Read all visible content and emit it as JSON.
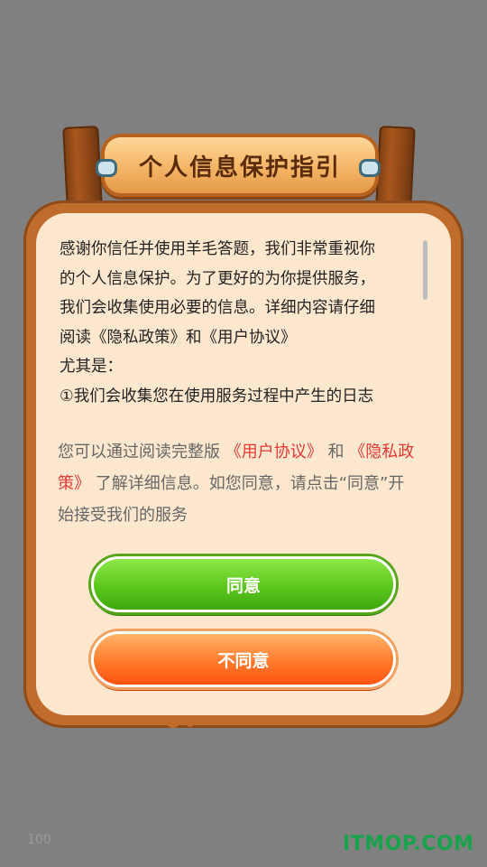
{
  "dialog": {
    "title": "个人信息保护指引",
    "agreement_lines": [
      "感谢你信任并使用羊毛答题，我们非常重视你",
      "的个人信息保护。为了更好的为你提供服务，",
      "我们会收集使用必要的信息。详细内容请仔细",
      "阅读《隐私政策》和《用户协议》",
      "尤其是：",
      "①我们会收集您在使用服务过程中产生的日志"
    ],
    "notice": {
      "part1": "您可以通过阅读完整版",
      "link_user_agreement": "《用户协议》",
      "and": "和",
      "link_privacy": "《隐私政策》",
      "part2": "了解详细信息。如您同意，请点击“同意”开始接受我们的服务"
    },
    "agree_button": "同意",
    "disagree_button": "不同意"
  },
  "footer": {
    "page_num": "100",
    "watermark": "ITMOP.COM"
  },
  "colors": {
    "background": "#808080",
    "link": "#e53935",
    "agree_green": "#5cc71c",
    "disagree_orange": "#ff6a1f"
  }
}
